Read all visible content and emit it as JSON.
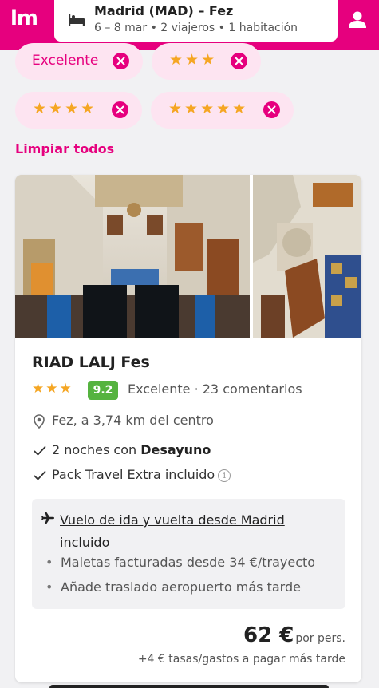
{
  "app": {
    "logo": "lm"
  },
  "search": {
    "route": "Madrid (MAD) – Fez",
    "details": "6 – 8 mar • 2 viajeros • 1 habitación"
  },
  "filters": {
    "chips": [
      {
        "label": "Excelente"
      },
      {
        "stars": "★★★"
      },
      {
        "stars": "★★★★"
      },
      {
        "stars": "★★★★★"
      }
    ],
    "clear_all": "Limpiar todos"
  },
  "hotel": {
    "name": "RIAD LALJ Fes",
    "stars": "★★★",
    "score": "9.2",
    "review_text": "Excelente · 23 comentarios",
    "location": "Fez, a 3,74 km del centro",
    "features": {
      "nights_prefix": "2 noches con ",
      "nights_board": "Desayuno",
      "pack": "Pack Travel Extra incluido"
    },
    "info_icon": "i",
    "flight": {
      "title": "Vuelo de ida y vuelta desde Madrid incluido",
      "bullets": [
        "Maletas facturadas desde 34 €/trayecto",
        "Añade traslado aeropuerto más tarde"
      ],
      "bullet_char": "•"
    },
    "price": {
      "amount": "62 €",
      "per": "por pers.",
      "taxes": "+4 € tasas/gastos a pagar más tarde"
    }
  },
  "colors": {
    "brand": "#e6007e",
    "chip_bg": "#fde4f1",
    "star": "#f5a623",
    "score_bg": "#55b33f"
  },
  "icons": [
    "bed-icon",
    "user-icon",
    "close-icon",
    "location-pin-icon",
    "check-icon",
    "info-icon",
    "plane-icon"
  ]
}
